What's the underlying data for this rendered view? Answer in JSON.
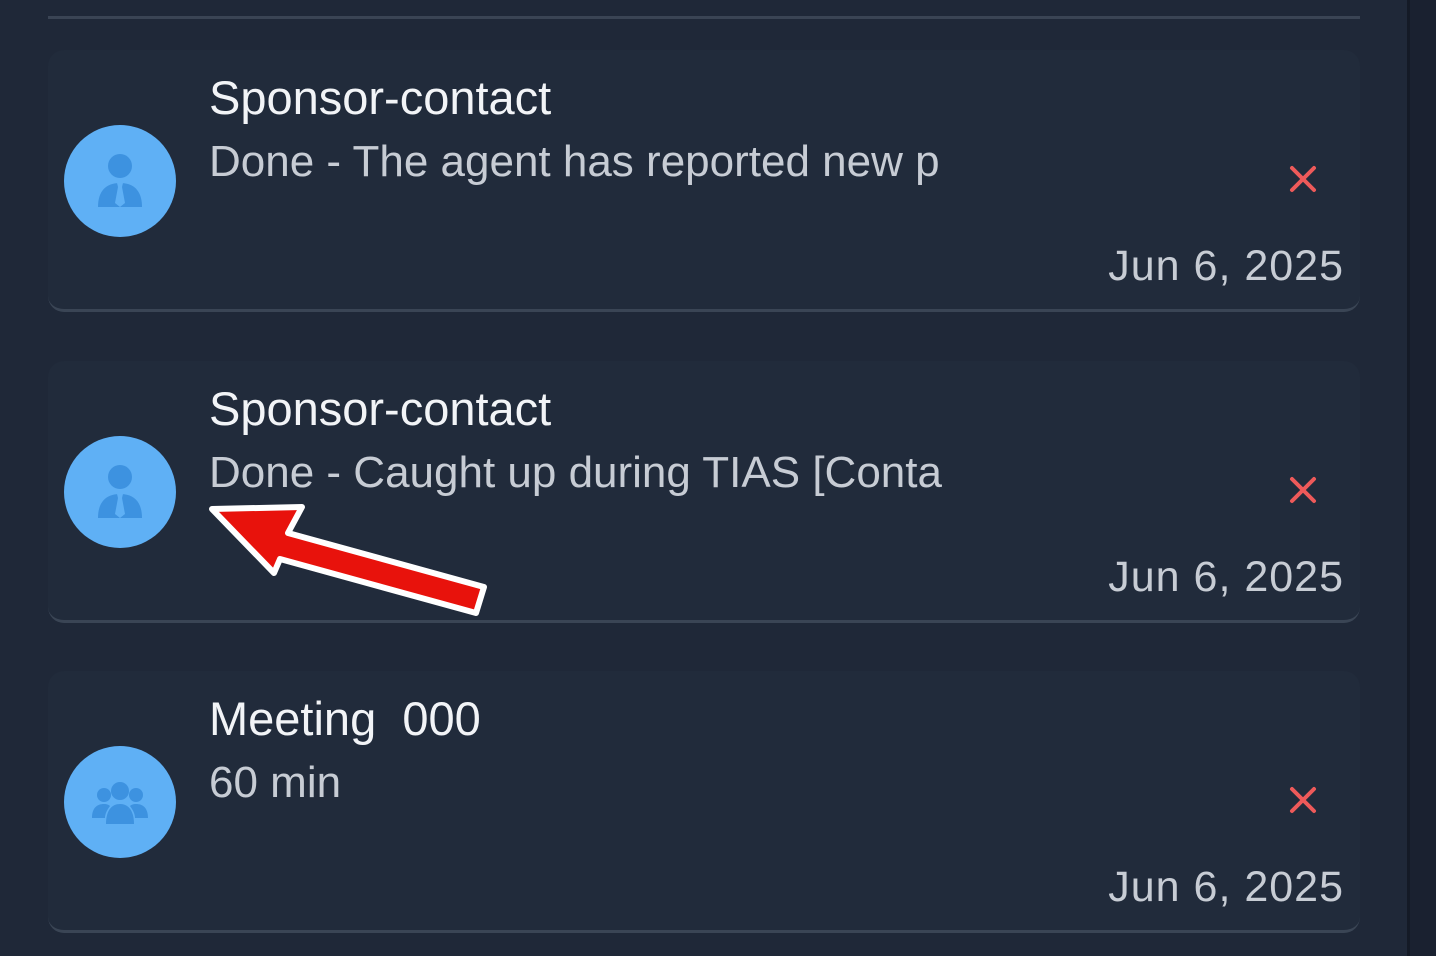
{
  "list": {
    "items": [
      {
        "title": "Sponsor-contact",
        "subtitle": "Done - The agent has reported new p",
        "date": "Jun 6, 2025",
        "avatar_icon": "person-tie-icon",
        "delete_icon": "close-icon"
      },
      {
        "title": "Sponsor-contact",
        "subtitle": "Done - Caught up during TIAS [Conta",
        "date": "Jun 6, 2025",
        "avatar_icon": "person-tie-icon",
        "delete_icon": "close-icon"
      },
      {
        "title": "Meeting  000",
        "subtitle": "60 min",
        "date": "Jun 6, 2025",
        "avatar_icon": "group-icon",
        "delete_icon": "close-icon"
      }
    ]
  },
  "colors": {
    "background": "#1f2838",
    "avatar": "#5fb0f5",
    "avatar_glyph": "#3d92e0",
    "delete": "#ee5a5a",
    "annotation_arrow": "#e8120c"
  },
  "annotation": {
    "icon": "red-arrow-icon"
  }
}
